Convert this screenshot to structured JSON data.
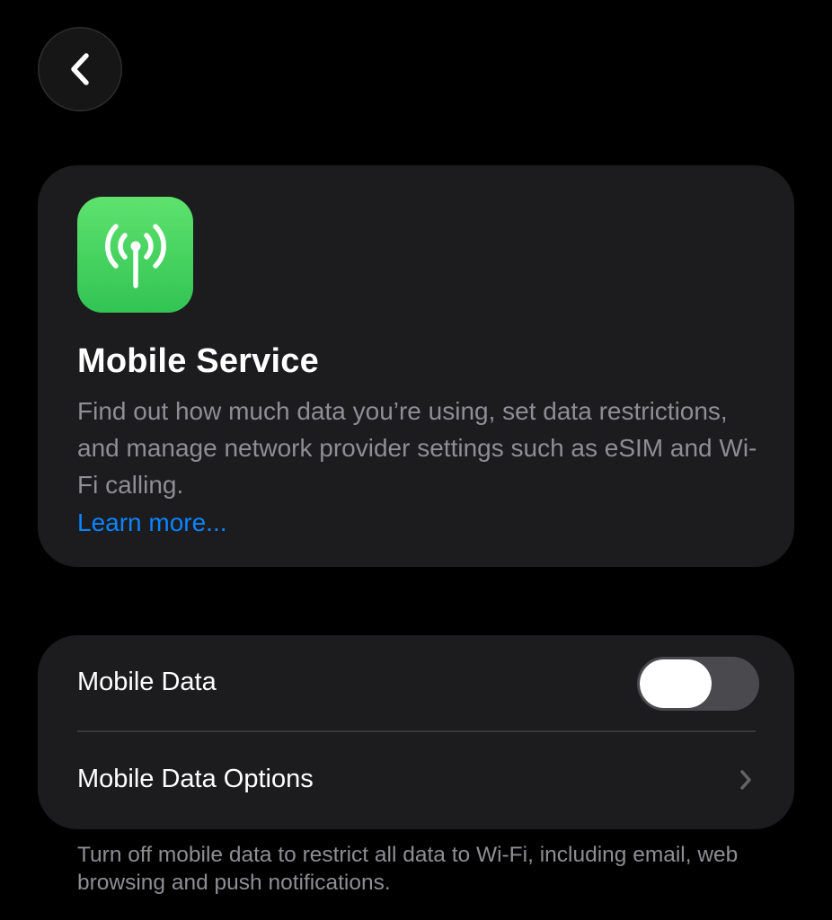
{
  "navigation": {
    "back_icon": "chevron-left-icon"
  },
  "hero": {
    "icon": "antenna-radiowaves-icon",
    "icon_color": "#34c759",
    "title": "Mobile Service",
    "description": "Find out how much data you’re using, set data restrictions, and manage network provider settings such as eSIM and Wi-Fi calling.",
    "link_label": "Learn more...",
    "link_color": "#0a84ff"
  },
  "settings": {
    "mobile_data": {
      "label": "Mobile Data",
      "enabled": false
    },
    "mobile_data_options": {
      "label": "Mobile Data Options",
      "icon": "chevron-right-icon"
    }
  },
  "footer": {
    "note": "Turn off mobile data to restrict all data to Wi-Fi, including email, web browsing and push notifications."
  }
}
